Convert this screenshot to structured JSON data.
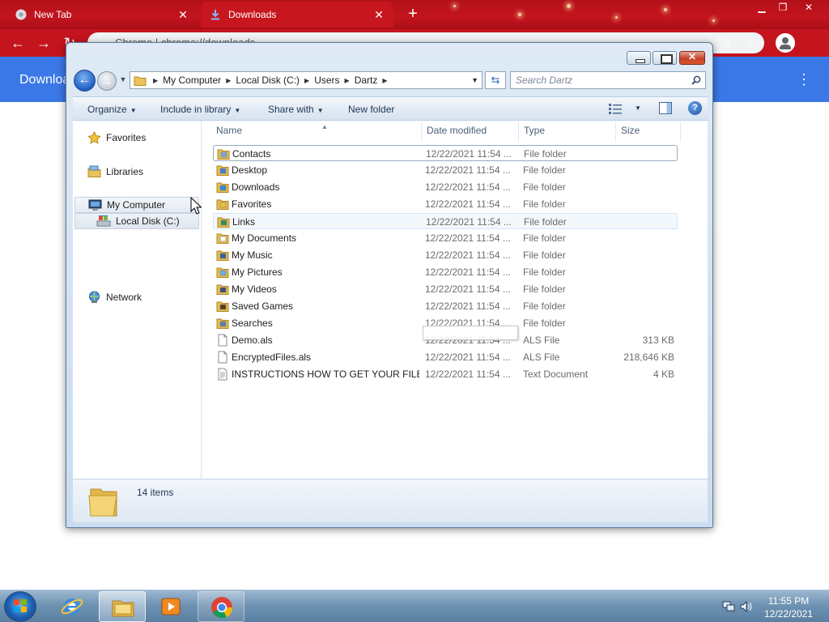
{
  "chrome": {
    "tabs": [
      {
        "label": "New Tab",
        "active": false
      },
      {
        "label": "Downloads",
        "active": true
      }
    ],
    "new_tab_symbol": "+",
    "address": "Chrome  |  chrome://downloads",
    "page_title": "Downloads",
    "colors": {
      "theme_red": "#c4141e",
      "header_blue": "#3b78e7"
    }
  },
  "explorer": {
    "breadcrumb": [
      "My Computer",
      "Local Disk (C:)",
      "Users",
      "Dartz"
    ],
    "search_placeholder": "Search Dartz",
    "toolbar": {
      "organize": "Organize",
      "include_in_library": "Include in library",
      "share_with": "Share with",
      "new_folder": "New folder"
    },
    "nav": {
      "favorites": "Favorites",
      "libraries": "Libraries",
      "my_computer": "My Computer",
      "local_disk": "Local Disk (C:)",
      "network": "Network"
    },
    "columns": {
      "name": "Name",
      "date": "Date modified",
      "type": "Type",
      "size": "Size"
    },
    "files": [
      {
        "name": "Contacts",
        "date": "12/22/2021 11:54 ...",
        "type": "File folder",
        "size": "",
        "icon": "contacts-folder-icon"
      },
      {
        "name": "Desktop",
        "date": "12/22/2021 11:54 ...",
        "type": "File folder",
        "size": "",
        "icon": "desktop-folder-icon"
      },
      {
        "name": "Downloads",
        "date": "12/22/2021 11:54 ...",
        "type": "File folder",
        "size": "",
        "icon": "downloads-folder-icon"
      },
      {
        "name": "Favorites",
        "date": "12/22/2021 11:54 ...",
        "type": "File folder",
        "size": "",
        "icon": "favorites-folder-icon"
      },
      {
        "name": "Links",
        "date": "12/22/2021 11:54 ...",
        "type": "File folder",
        "size": "",
        "icon": "links-folder-icon"
      },
      {
        "name": "My Documents",
        "date": "12/22/2021 11:54 ...",
        "type": "File folder",
        "size": "",
        "icon": "documents-folder-icon"
      },
      {
        "name": "My Music",
        "date": "12/22/2021 11:54 ...",
        "type": "File folder",
        "size": "",
        "icon": "music-folder-icon"
      },
      {
        "name": "My Pictures",
        "date": "12/22/2021 11:54 ...",
        "type": "File folder",
        "size": "",
        "icon": "pictures-folder-icon"
      },
      {
        "name": "My Videos",
        "date": "12/22/2021 11:54 ...",
        "type": "File folder",
        "size": "",
        "icon": "videos-folder-icon"
      },
      {
        "name": "Saved Games",
        "date": "12/22/2021 11:54 ...",
        "type": "File folder",
        "size": "",
        "icon": "saved-games-folder-icon"
      },
      {
        "name": "Searches",
        "date": "12/22/2021 11:54 ...",
        "type": "File folder",
        "size": "",
        "icon": "searches-folder-icon"
      },
      {
        "name": "Demo.als",
        "date": "12/22/2021 11:54 ...",
        "type": "ALS File",
        "size": "313 KB",
        "icon": "file-icon"
      },
      {
        "name": "EncryptedFiles.als",
        "date": "12/22/2021 11:54 ...",
        "type": "ALS File",
        "size": "218,646 KB",
        "icon": "file-icon"
      },
      {
        "name": "INSTRUCTIONS HOW TO GET YOUR FILE...",
        "date": "12/22/2021 11:54 ...",
        "type": "Text Document",
        "size": "4 KB",
        "icon": "text-document-icon"
      }
    ],
    "status": {
      "item_count": "14 items"
    }
  },
  "taskbar": {
    "apps": [
      {
        "name": "internet-explorer-icon",
        "state": "pinned"
      },
      {
        "name": "windows-explorer-icon",
        "state": "active"
      },
      {
        "name": "media-player-icon",
        "state": "pinned"
      },
      {
        "name": "chrome-icon",
        "state": "open"
      }
    ],
    "clock_time": "11:55 PM",
    "clock_date": "12/22/2021"
  }
}
